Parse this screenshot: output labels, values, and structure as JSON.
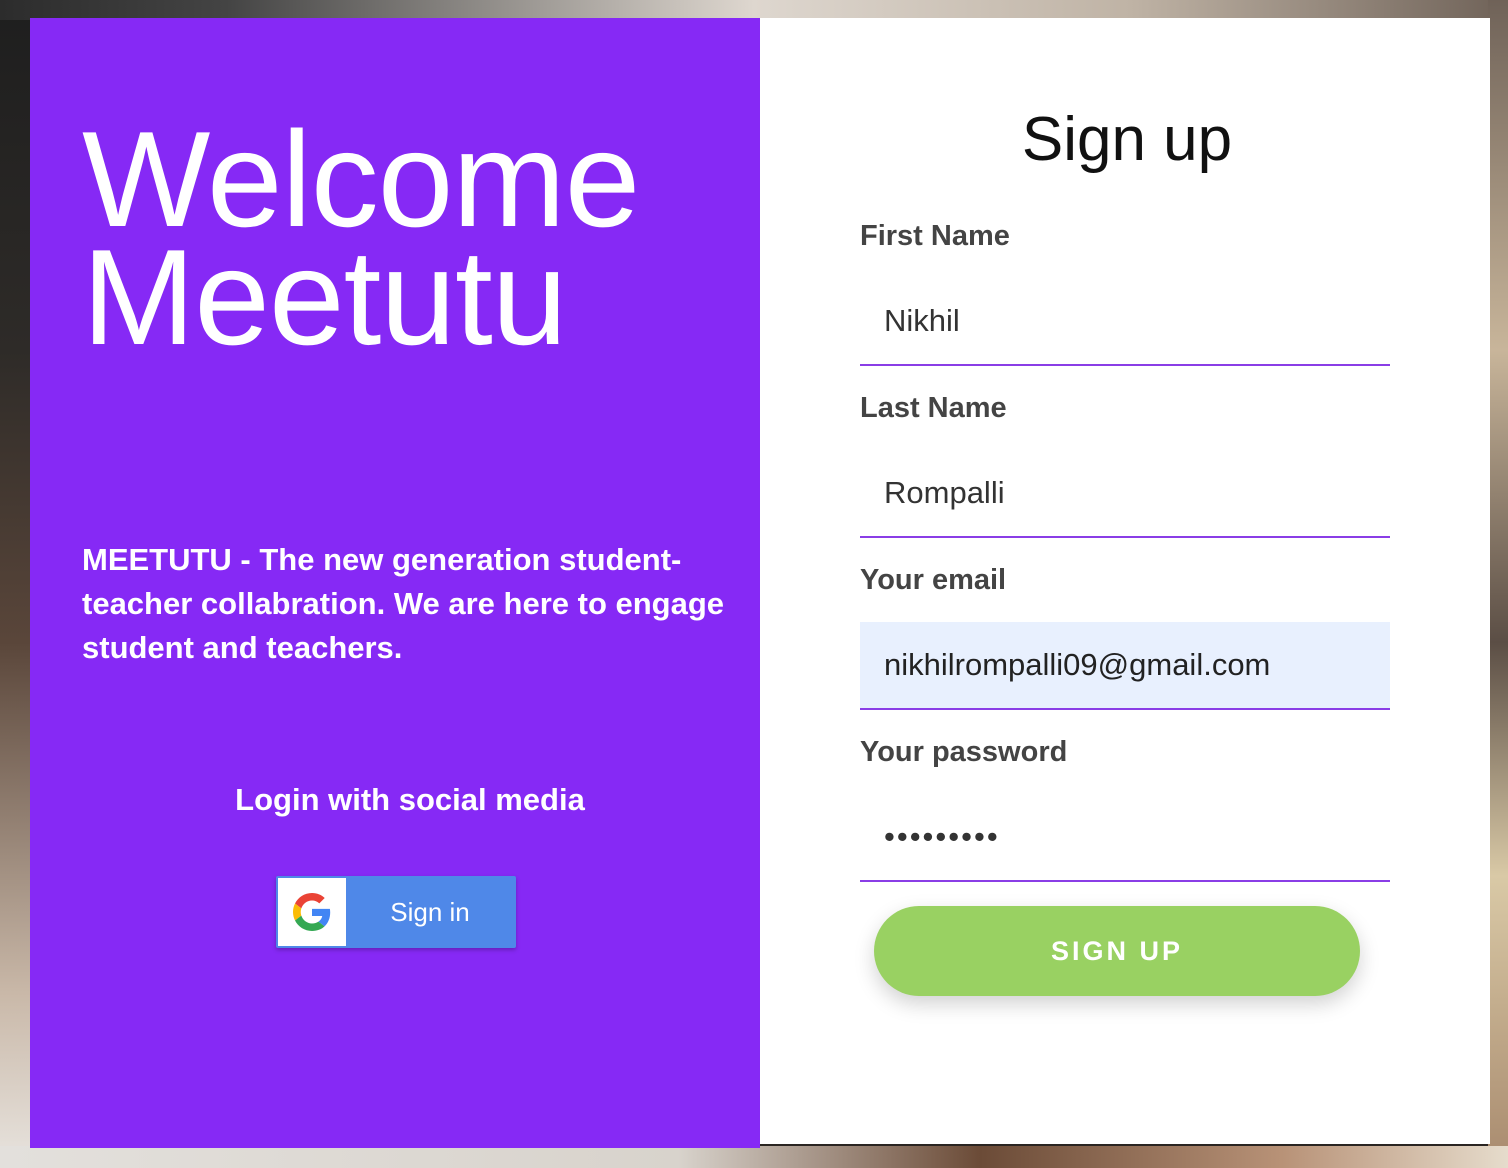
{
  "welcome": {
    "line1": "Welcome",
    "line2": "Meetutu"
  },
  "tagline": "MEETUTU - The new generation student-teacher collabration. We are here to engage student and teachers.",
  "social": {
    "title": "Login with social media",
    "google_button_label": "Sign in",
    "google_icon": "google-g-icon"
  },
  "signup": {
    "title": "Sign up",
    "fields": [
      {
        "label": "First Name",
        "value": "Nikhil"
      },
      {
        "label": "Last Name",
        "value": "Rompalli"
      },
      {
        "label": "Your email",
        "value": "nikhilrompalli09@gmail.com"
      },
      {
        "label": "Your password",
        "value": "•••••••••"
      }
    ],
    "submit_label": "SIGN UP"
  },
  "colors": {
    "panel_purple": "#8629f5",
    "button_green": "#99d162",
    "google_blue": "#4f88e8",
    "input_underline": "#8a3de6",
    "autofill_bg": "#e8f0fe"
  }
}
